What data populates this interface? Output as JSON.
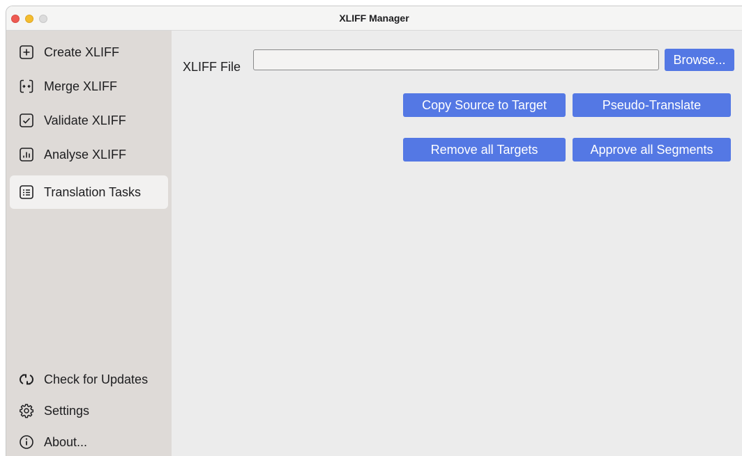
{
  "window": {
    "title": "XLIFF Manager"
  },
  "sidebar": {
    "items": [
      {
        "label": "Create XLIFF",
        "icon": "plus-square-icon"
      },
      {
        "label": "Merge XLIFF",
        "icon": "merge-icon"
      },
      {
        "label": "Validate XLIFF",
        "icon": "checkbox-icon"
      },
      {
        "label": "Analyse XLIFF",
        "icon": "bar-chart-icon"
      },
      {
        "label": "Translation Tasks",
        "icon": "list-icon",
        "active": true
      }
    ],
    "footer_items": [
      {
        "label": "Check for Updates",
        "icon": "refresh-icon"
      },
      {
        "label": "Settings",
        "icon": "gear-icon"
      },
      {
        "label": "About...",
        "icon": "info-icon"
      }
    ]
  },
  "main": {
    "file_label": "XLIFF File",
    "file_value": "",
    "browse_label": "Browse...",
    "actions": {
      "copy_source": "Copy Source to Target",
      "pseudo_translate": "Pseudo-Translate",
      "remove_targets": "Remove all Targets",
      "approve_segments": "Approve all Segments"
    }
  },
  "colors": {
    "accent": "#5478e4",
    "sidebar_bg": "#dedad7",
    "content_bg": "#ececec",
    "selected_item_bg": "#f2f1f0"
  }
}
